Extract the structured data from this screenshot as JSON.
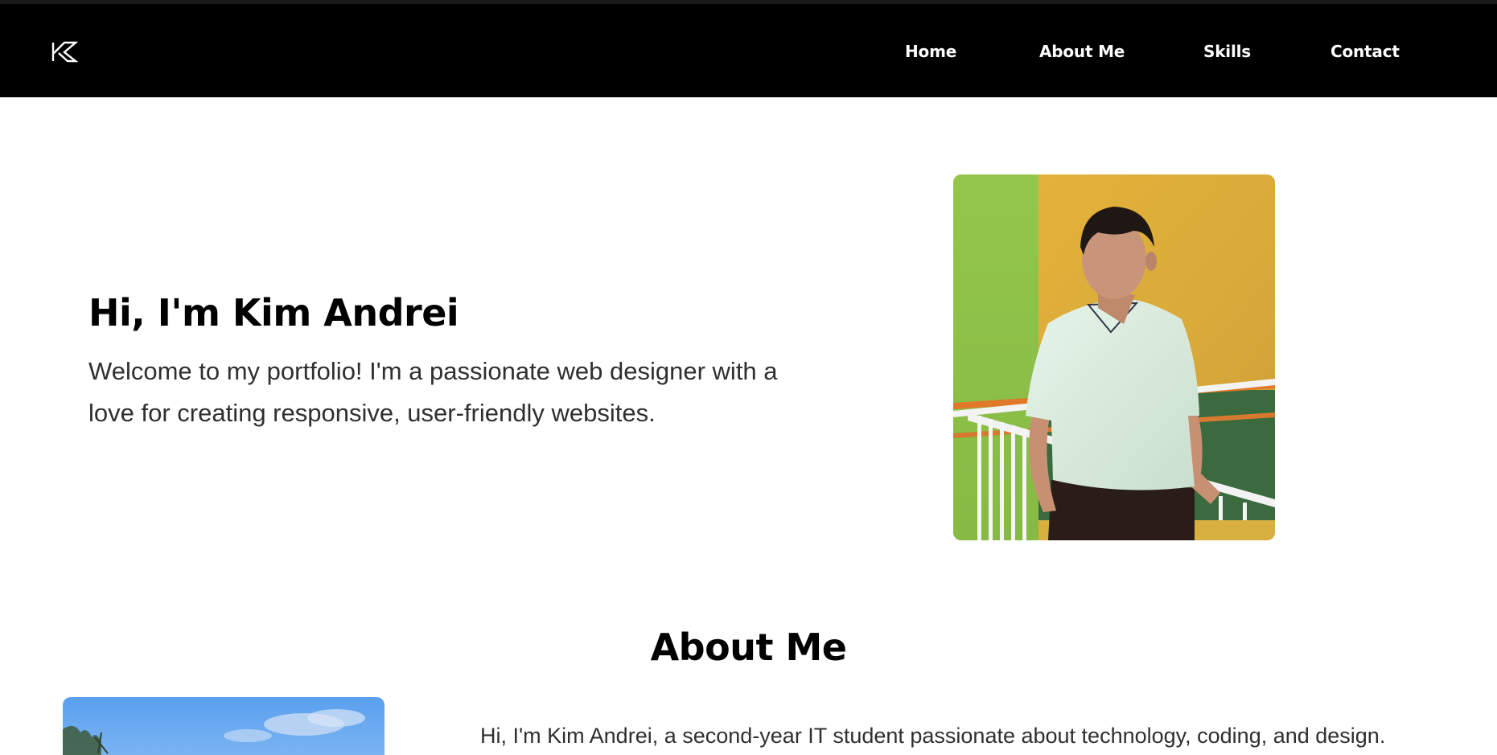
{
  "nav": {
    "logo_name": "K logo",
    "items": [
      {
        "label": "Home"
      },
      {
        "label": "About Me"
      },
      {
        "label": "Skills"
      },
      {
        "label": "Contact"
      }
    ]
  },
  "hero": {
    "title": "Hi, I'm Kim Andrei",
    "text": "Welcome to my portfolio! I'm a passionate web designer with a love for creating responsive, user-friendly websites."
  },
  "about": {
    "title": "About Me",
    "text": "Hi, I'm Kim Andrei, a second-year IT student passionate about technology, coding, and design."
  },
  "colors": {
    "navbar_bg": "#000000",
    "nav_text": "#ffffff",
    "body_bg": "#ffffff",
    "heading": "#000000",
    "body_text": "#2f2f2f"
  }
}
